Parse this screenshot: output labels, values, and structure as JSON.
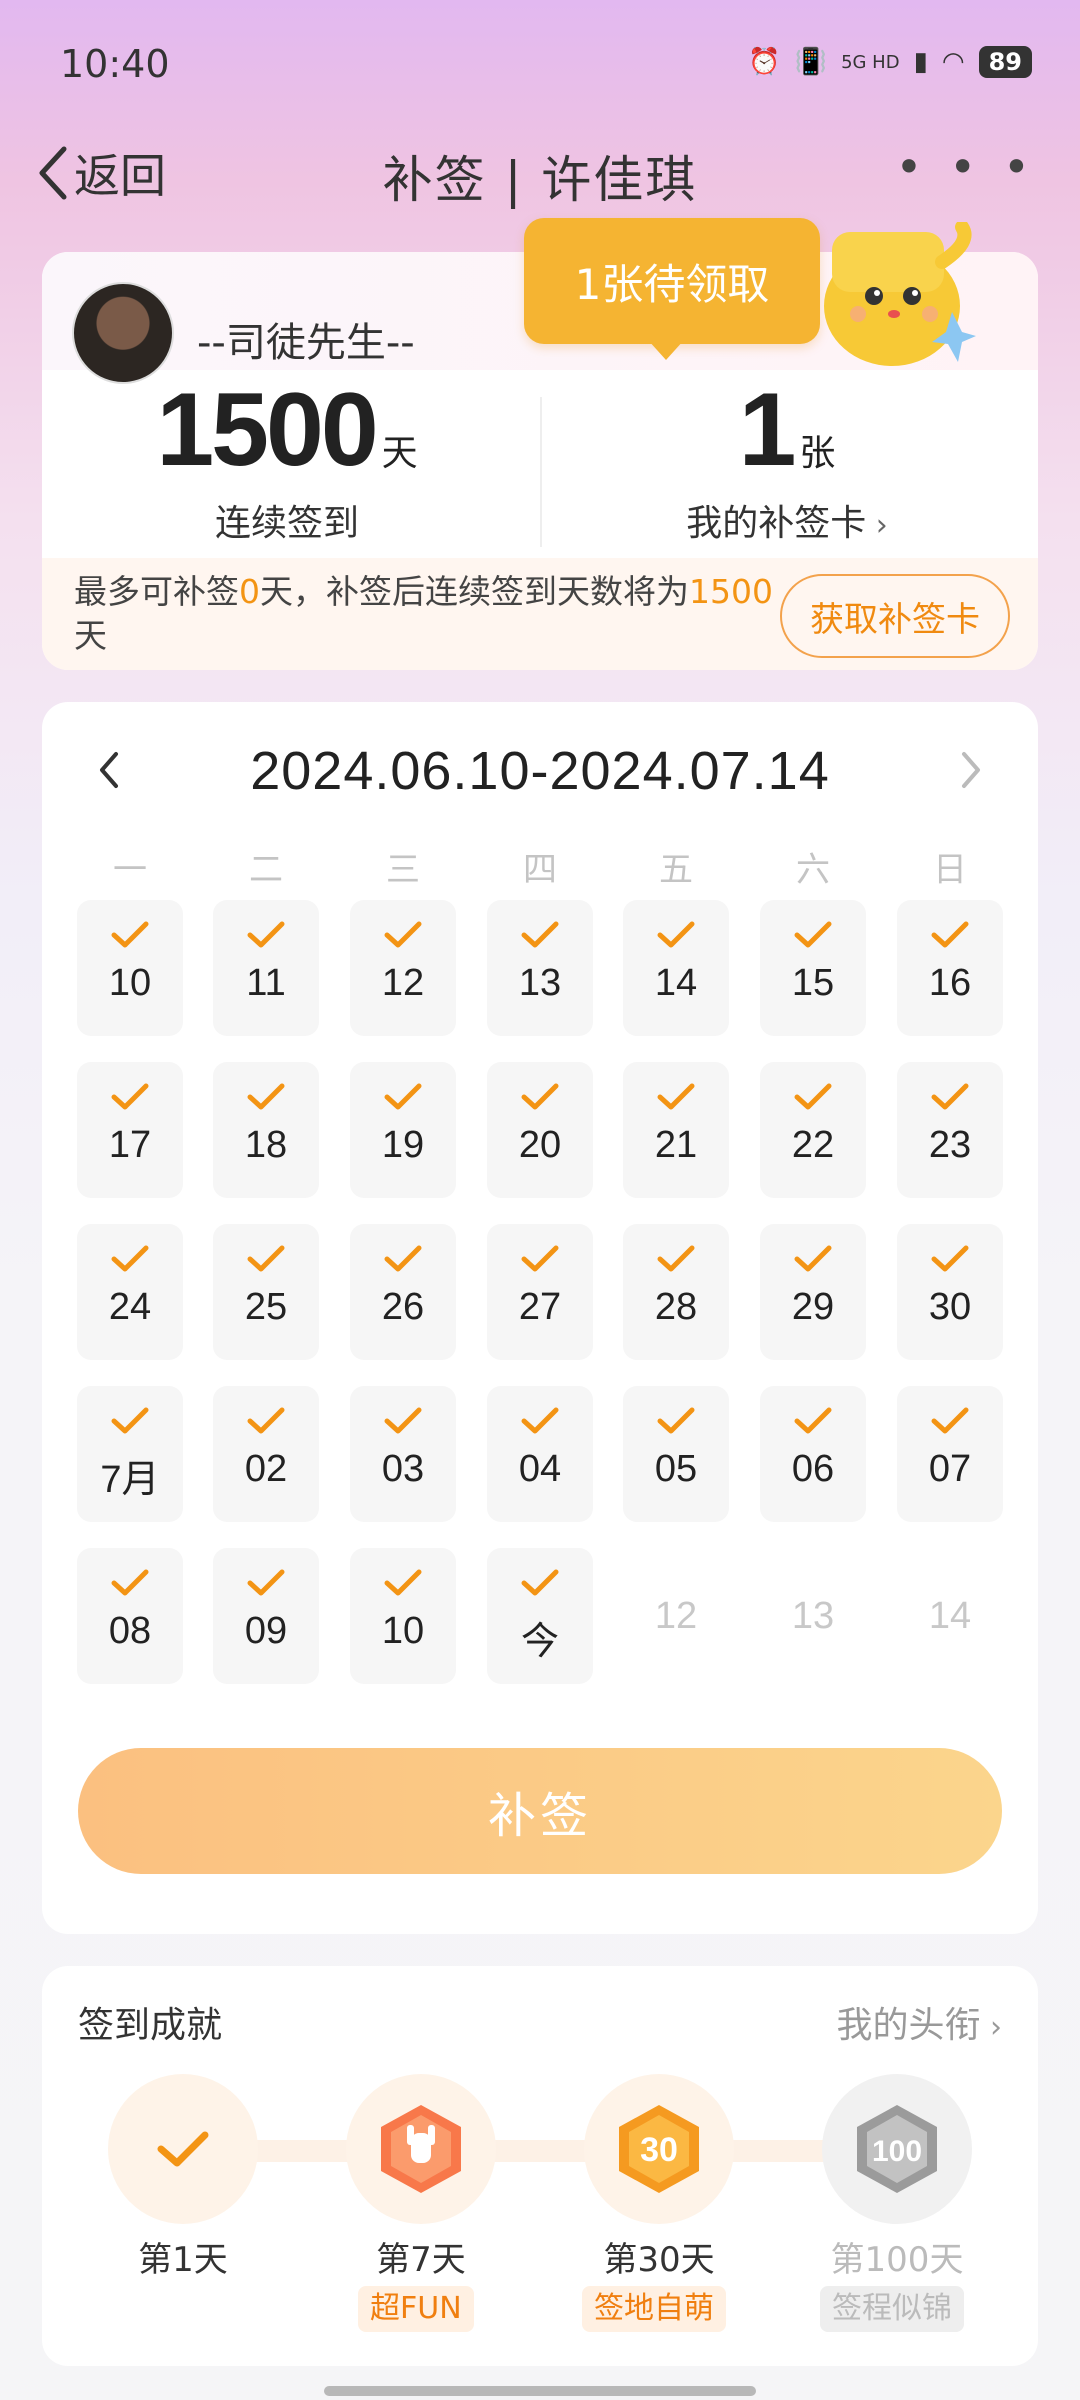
{
  "status_bar": {
    "time": "10:40",
    "network": "5G HD",
    "battery": "89"
  },
  "nav": {
    "back_label": "返回",
    "title": "补签 | 许佳琪"
  },
  "profile": {
    "username": "--司徒先生--",
    "streak_days": "1500",
    "streak_unit": "天",
    "streak_label": "连续签到",
    "card_count": "1",
    "card_unit": "张",
    "card_label": "我的补签卡",
    "pending_bubble": "1张待领取"
  },
  "tip": {
    "part1": "最多可补签",
    "max_days": "0",
    "part2": "天，补签后连续签到天数将为",
    "result_days": "1500",
    "part3": "天",
    "get_card_button": "获取补签卡"
  },
  "calendar": {
    "range": "2024.06.10-2024.07.14",
    "weekdays": [
      "一",
      "二",
      "三",
      "四",
      "五",
      "六",
      "日"
    ],
    "check_color": "#f39414",
    "days": [
      {
        "label": "10",
        "checked": true
      },
      {
        "label": "11",
        "checked": true
      },
      {
        "label": "12",
        "checked": true
      },
      {
        "label": "13",
        "checked": true
      },
      {
        "label": "14",
        "checked": true
      },
      {
        "label": "15",
        "checked": true
      },
      {
        "label": "16",
        "checked": true
      },
      {
        "label": "17",
        "checked": true
      },
      {
        "label": "18",
        "checked": true
      },
      {
        "label": "19",
        "checked": true
      },
      {
        "label": "20",
        "checked": true
      },
      {
        "label": "21",
        "checked": true
      },
      {
        "label": "22",
        "checked": true
      },
      {
        "label": "23",
        "checked": true
      },
      {
        "label": "24",
        "checked": true
      },
      {
        "label": "25",
        "checked": true
      },
      {
        "label": "26",
        "checked": true
      },
      {
        "label": "27",
        "checked": true
      },
      {
        "label": "28",
        "checked": true
      },
      {
        "label": "29",
        "checked": true
      },
      {
        "label": "30",
        "checked": true
      },
      {
        "label": "7月",
        "checked": true
      },
      {
        "label": "02",
        "checked": true
      },
      {
        "label": "03",
        "checked": true
      },
      {
        "label": "04",
        "checked": true
      },
      {
        "label": "05",
        "checked": true
      },
      {
        "label": "06",
        "checked": true
      },
      {
        "label": "07",
        "checked": true
      },
      {
        "label": "08",
        "checked": true
      },
      {
        "label": "09",
        "checked": true
      },
      {
        "label": "10",
        "checked": true
      },
      {
        "label": "今",
        "checked": true
      },
      {
        "label": "12",
        "checked": false
      },
      {
        "label": "13",
        "checked": false
      },
      {
        "label": "14",
        "checked": false
      }
    ]
  },
  "buqian_button": "补签",
  "achievements": {
    "title": "签到成就",
    "link": "我的头衔",
    "items": [
      {
        "day": "第1天",
        "tag": "",
        "icon": "check-icon",
        "unlocked": true
      },
      {
        "day": "第7天",
        "tag": "超FUN",
        "icon": "rock-hand-badge-icon",
        "unlocked": true
      },
      {
        "day": "第30天",
        "tag": "签地自萌",
        "icon": "30-days-badge-icon",
        "unlocked": true
      },
      {
        "day": "第100天",
        "tag": "签程似锦",
        "icon": "100-days-badge-icon",
        "unlocked": false
      }
    ]
  }
}
